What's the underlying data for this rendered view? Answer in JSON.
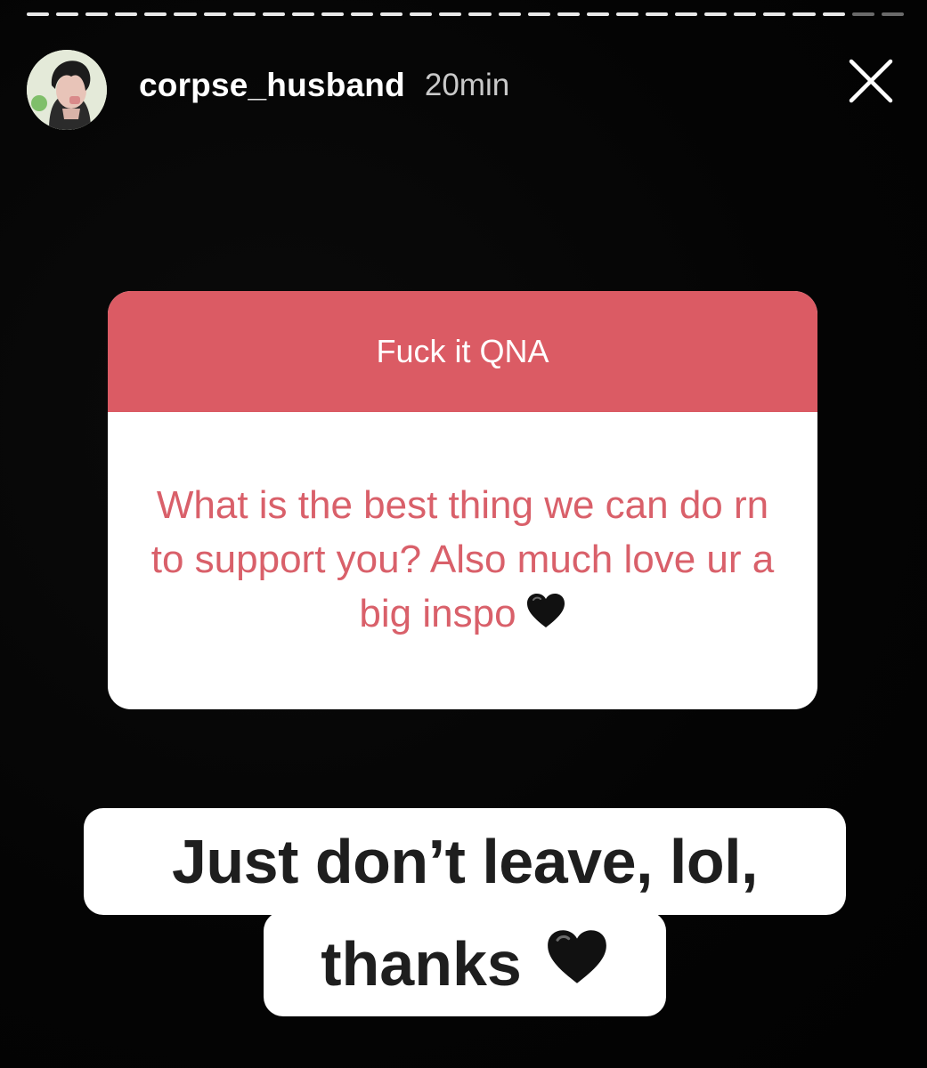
{
  "story": {
    "username": "corpse_husband",
    "time": "20min"
  },
  "question_sticker": {
    "title": "Fuck it QNA",
    "question": "What is the best thing we can do rn to support you? Also much love ur a big inspo",
    "question_emoji": "black-heart-icon",
    "header_color": "#db5b64",
    "text_color": "#d9606a"
  },
  "answer": {
    "line1": "Just don’t leave, lol,",
    "line2": "thanks",
    "emoji": "black-heart-icon"
  },
  "icons": {
    "close": "close-icon",
    "avatar": "avatar"
  }
}
